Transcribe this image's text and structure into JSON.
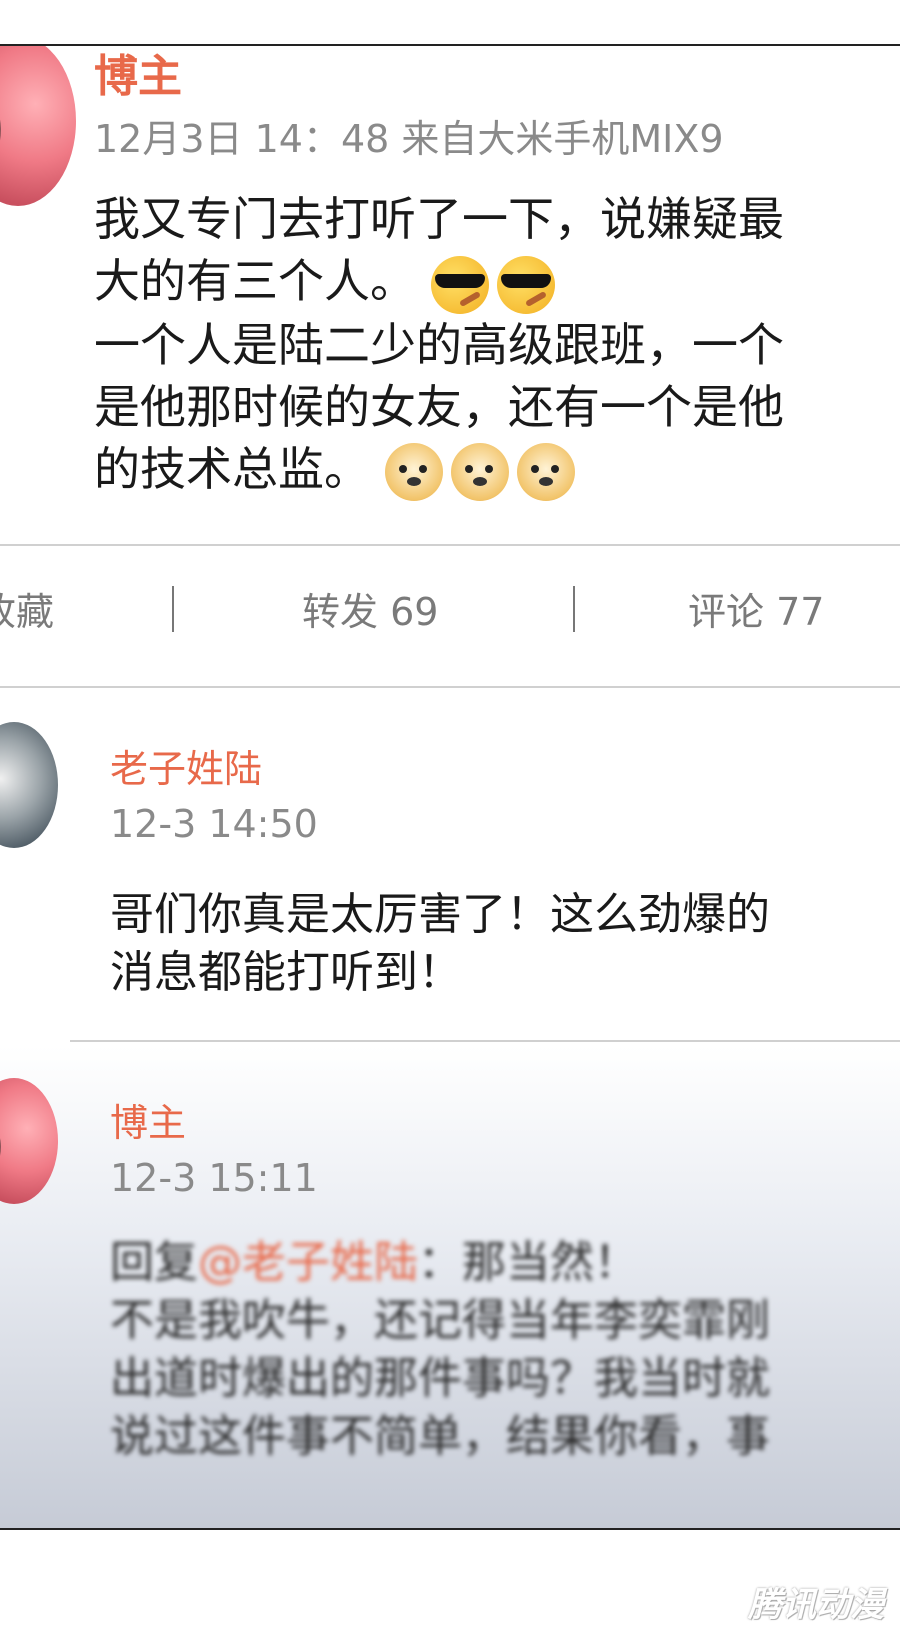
{
  "post": {
    "author": "博主",
    "meta": "12月3日 14：48  来自大米手机MIX9",
    "lines": [
      "我又专门去打听了一下，说嫌疑最",
      "大的有三个人。",
      "一个人是陆二少的高级跟班，一个",
      "是他那时候的女友，还有一个是他",
      "的技术总监。"
    ],
    "emoji_line2": [
      "cool-emoji",
      "cool-emoji"
    ],
    "emoji_line5": [
      "doge-emoji",
      "doge-emoji",
      "doge-emoji"
    ]
  },
  "actions": {
    "favorite": "收藏",
    "repost": "转发 69",
    "comment": "评论 77"
  },
  "comments": [
    {
      "author": "老子姓陆",
      "time": "12-3 14:50",
      "lines": [
        "哥们你真是太厉害了！这么劲爆的",
        "消息都能打听到！"
      ]
    },
    {
      "author": "博主",
      "time": "12-3 15:11",
      "reply_prefix": "回复",
      "mention": "@老子姓陆",
      "reply_text": "：那当然！",
      "lines": [
        "不是我吹牛，还记得当年李奕霏刚",
        "出道时爆出的那件事吗？我当时就",
        "说过这件事不简单，结果你看，事"
      ]
    }
  ],
  "watermark": "腾讯动漫"
}
